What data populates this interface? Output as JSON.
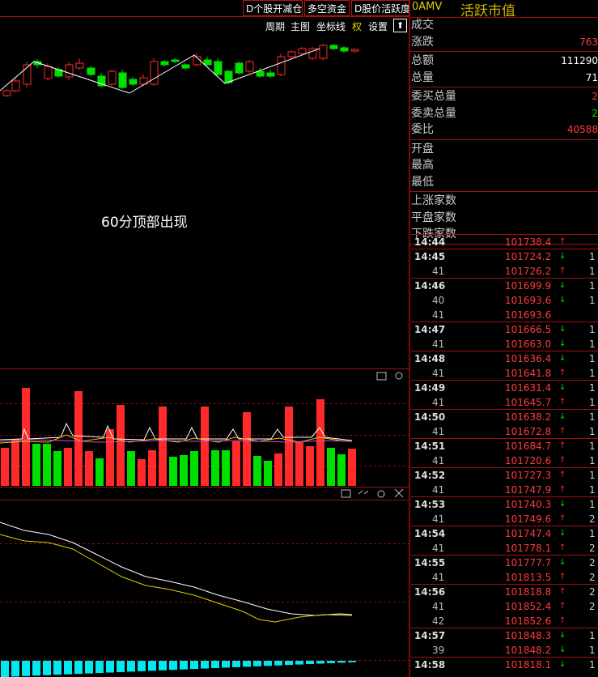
{
  "toolbar": {
    "btn_reduce": "D个股开减仓",
    "btn_capital": "多空资金",
    "btn_activity": "D股价活跃度",
    "menu": [
      "周期",
      "主图",
      "坐标线",
      "权",
      "设置"
    ]
  },
  "header": {
    "code": "0AMV",
    "name": "活跃市值"
  },
  "annotation": "60分顶部出现",
  "quote": {
    "labels1": [
      "成交",
      "涨跌"
    ],
    "values1": [
      "",
      "763"
    ],
    "labels2": [
      "总额",
      "总量"
    ],
    "values2": [
      "111290",
      "71"
    ],
    "labels3": [
      "委买总量",
      "委卖总量",
      "委比"
    ],
    "values3": [
      "2",
      "2",
      "40588"
    ],
    "labels4": [
      "开盘",
      "最高",
      "最低"
    ],
    "labels5": [
      "上涨家数",
      "平盘家数",
      "下跌家数"
    ]
  },
  "ticks": [
    {
      "t": "14:44",
      "p": "101738.4",
      "d": "up",
      "v": ""
    },
    {
      "t": "14:45",
      "p": "101724.2",
      "d": "down",
      "v": "1"
    },
    {
      "t": "41",
      "p": "101726.2",
      "d": "up",
      "v": "1"
    },
    {
      "t": "14:46",
      "p": "101699.9",
      "d": "down",
      "v": "1"
    },
    {
      "t": "40",
      "p": "101693.6",
      "d": "down",
      "v": "1"
    },
    {
      "t": "41",
      "p": "101693.6",
      "d": "",
      "v": ""
    },
    {
      "t": "14:47",
      "p": "101666.5",
      "d": "down",
      "v": "1"
    },
    {
      "t": "41",
      "p": "101663.0",
      "d": "down",
      "v": "1"
    },
    {
      "t": "14:48",
      "p": "101636.4",
      "d": "down",
      "v": "1"
    },
    {
      "t": "41",
      "p": "101641.8",
      "d": "up",
      "v": "1"
    },
    {
      "t": "14:49",
      "p": "101631.4",
      "d": "down",
      "v": "1"
    },
    {
      "t": "41",
      "p": "101645.7",
      "d": "up",
      "v": "1"
    },
    {
      "t": "14:50",
      "p": "101638.2",
      "d": "down",
      "v": "1"
    },
    {
      "t": "41",
      "p": "101672.8",
      "d": "up",
      "v": "1"
    },
    {
      "t": "14:51",
      "p": "101684.7",
      "d": "up",
      "v": "1"
    },
    {
      "t": "41",
      "p": "101720.6",
      "d": "up",
      "v": "1"
    },
    {
      "t": "14:52",
      "p": "101727.3",
      "d": "up",
      "v": "1"
    },
    {
      "t": "41",
      "p": "101747.9",
      "d": "up",
      "v": "1"
    },
    {
      "t": "14:53",
      "p": "101740.3",
      "d": "down",
      "v": "1"
    },
    {
      "t": "41",
      "p": "101749.6",
      "d": "up",
      "v": "2"
    },
    {
      "t": "14:54",
      "p": "101747.4",
      "d": "down",
      "v": "1"
    },
    {
      "t": "41",
      "p": "101778.1",
      "d": "up",
      "v": "2"
    },
    {
      "t": "14:55",
      "p": "101777.7",
      "d": "down",
      "v": "2"
    },
    {
      "t": "41",
      "p": "101813.5",
      "d": "up",
      "v": "2"
    },
    {
      "t": "14:56",
      "p": "101818.8",
      "d": "up",
      "v": "2"
    },
    {
      "t": "41",
      "p": "101852.4",
      "d": "up",
      "v": "2"
    },
    {
      "t": "42",
      "p": "101852.6",
      "d": "up",
      "v": ""
    },
    {
      "t": "14:57",
      "p": "101848.3",
      "d": "down",
      "v": "1"
    },
    {
      "t": "39",
      "p": "101848.2",
      "d": "down",
      "v": "1"
    },
    {
      "t": "14:58",
      "p": "101818.1",
      "d": "down",
      "v": "1"
    }
  ],
  "colors": {
    "up": "#ff2a2a",
    "down": "#00e000",
    "accent": "#c8b400"
  }
}
